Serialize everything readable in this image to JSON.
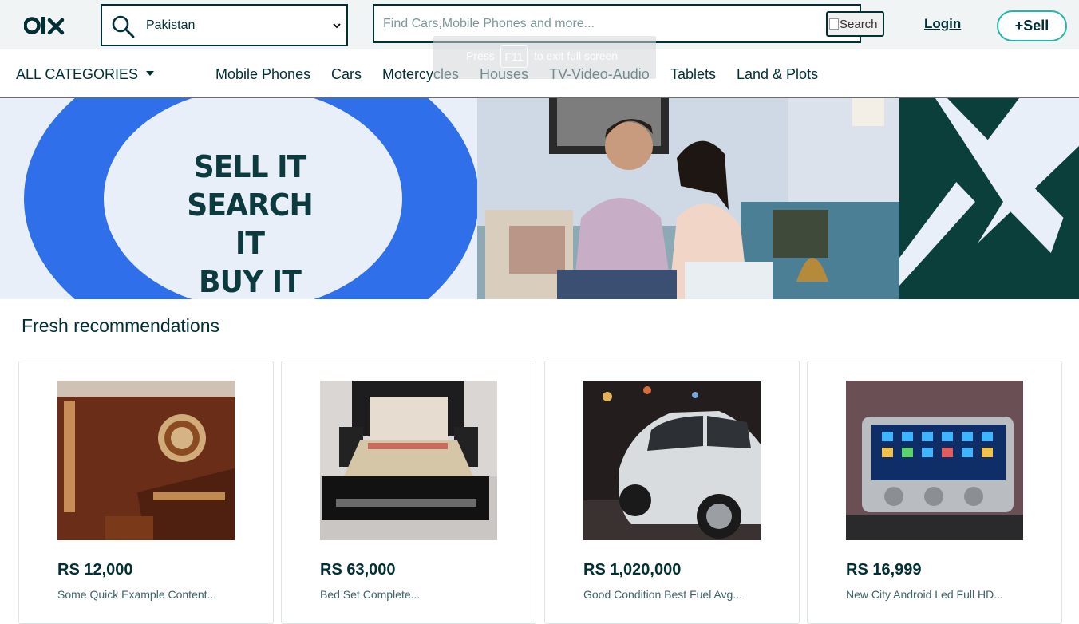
{
  "header": {
    "logo_text": "olx",
    "location_value": "Pakistan",
    "search_placeholder": "Find Cars,Mobile Phones and more...",
    "search_button_label": "Search",
    "login_label": "Login",
    "sell_label": "+Sell",
    "fullscreen_hint": {
      "prefix": "Press",
      "key": "F11",
      "suffix": "to exit full screen"
    }
  },
  "categories": {
    "all_label": "ALL CATEGORIES",
    "items": [
      "Mobile Phones",
      "Cars",
      "Motercycles",
      "Houses",
      "TV-Video-Audio",
      "Tablets",
      "Land & Plots"
    ]
  },
  "banner": {
    "slogan": [
      "SELL IT",
      "SEARCH IT",
      "BUY IT"
    ]
  },
  "recommendations": {
    "title": "Fresh recommendations",
    "cards": [
      {
        "price": "RS 12,000",
        "description": "Some Quick Example Content..."
      },
      {
        "price": "RS 63,000",
        "description": "Bed Set Complete..."
      },
      {
        "price": "RS 1,020,000",
        "description": "Good Condition Best Fuel Avg..."
      },
      {
        "price": "RS 16,999",
        "description": "New City Android Led Full HD..."
      }
    ]
  },
  "colors": {
    "brand_dark": "#002f34",
    "brand_teal": "#23b6a7",
    "banner_blue": "#2f6fea",
    "banner_green": "#0a3f3c"
  }
}
